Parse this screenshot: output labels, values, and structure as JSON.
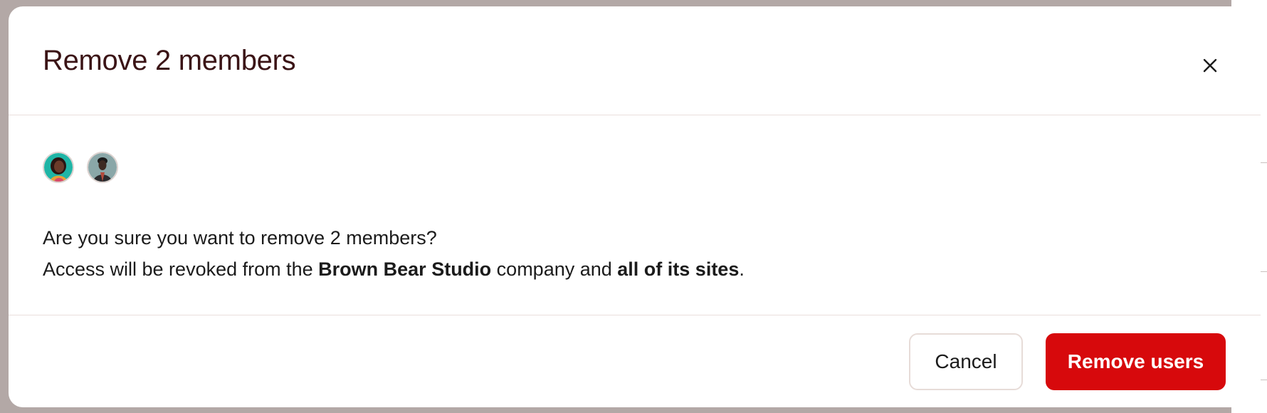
{
  "dialog": {
    "title": "Remove 2 members",
    "close_icon": "close-icon",
    "members": [
      {
        "avatar": "member-avatar-1",
        "ring_color": "#1fb5a6"
      },
      {
        "avatar": "member-avatar-2",
        "ring_color": "#8aa7a8"
      }
    ],
    "message": {
      "line1": "Are you sure you want to remove 2 members?",
      "line2_prefix": "Access will be revoked from the ",
      "company": "Brown Bear Studio",
      "line2_middle": " company and ",
      "scope": "all of its sites",
      "line2_suffix": "."
    },
    "cancel_label": "Cancel",
    "confirm_label": "Remove users"
  },
  "colors": {
    "title": "#3b1416",
    "danger": "#d7090c",
    "divider": "#eadfdc",
    "overlay": "#b3a8a6"
  }
}
